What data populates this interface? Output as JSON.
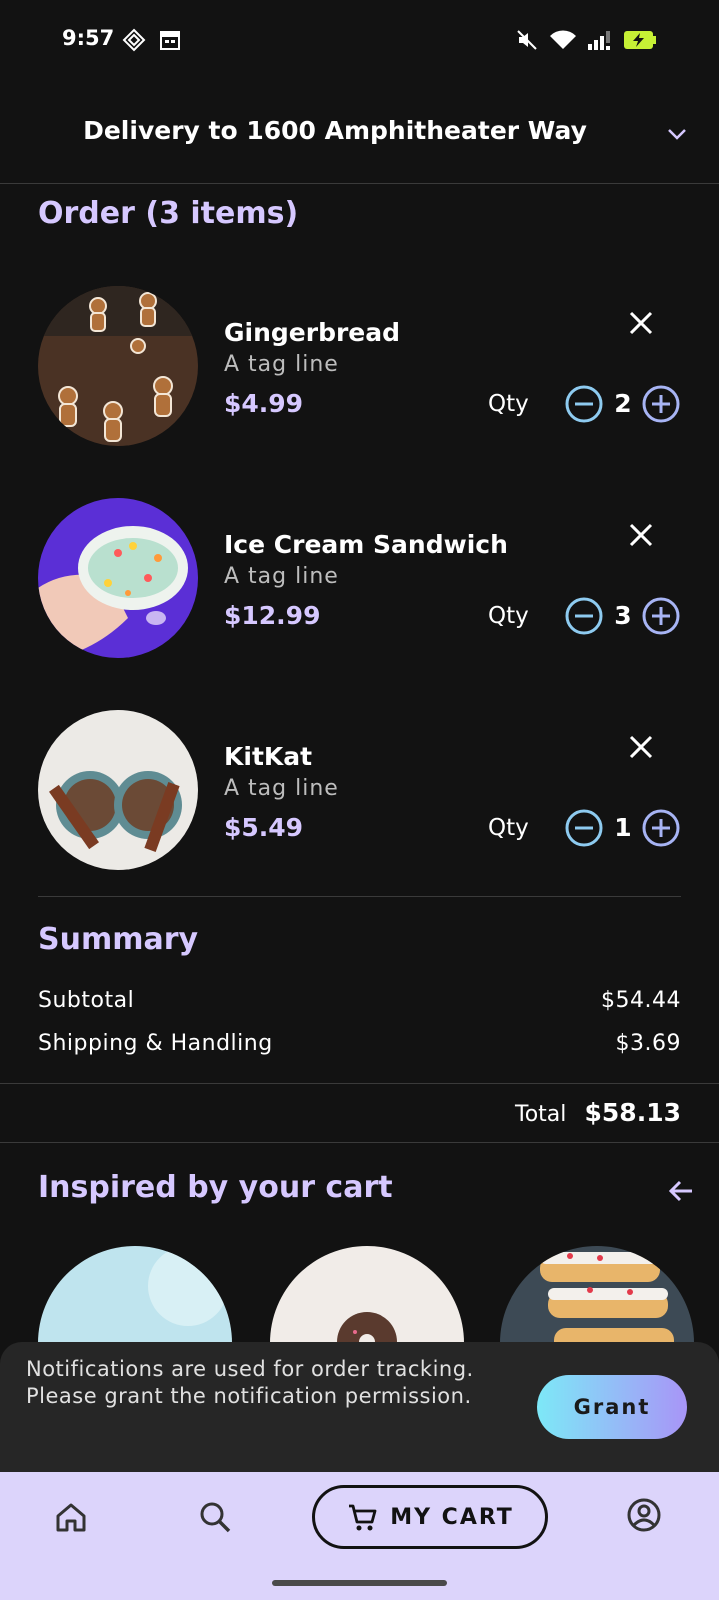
{
  "status_bar": {
    "time": "9:57"
  },
  "header": {
    "title": "Delivery to 1600 Amphitheater Way"
  },
  "order": {
    "title": "Order (3 items)",
    "qty_label": "Qty",
    "items": [
      {
        "name": "Gingerbread",
        "tagline": "A tag line",
        "price": "$4.99",
        "qty": "2"
      },
      {
        "name": "Ice Cream Sandwich",
        "tagline": "A tag line",
        "price": "$12.99",
        "qty": "3"
      },
      {
        "name": "KitKat",
        "tagline": "A tag line",
        "price": "$5.49",
        "qty": "1"
      }
    ]
  },
  "summary": {
    "title": "Summary",
    "subtotal_label": "Subtotal",
    "subtotal_value": "$54.44",
    "shipping_label": "Shipping & Handling",
    "shipping_value": "$3.69",
    "total_label": "Total",
    "total_value": "$58.13"
  },
  "inspired": {
    "title": "Inspired by your cart"
  },
  "snackbar": {
    "message": "Notifications are used for order tracking. Please grant the notification permission.",
    "grant_label": "Grant"
  },
  "bottom_nav": {
    "cart_label": "MY CART"
  },
  "colors": {
    "background": "#121212",
    "accent_purple": "#d6c8ff",
    "qty_button": "#8ecbf0",
    "nav_background": "#dcd4fb"
  }
}
